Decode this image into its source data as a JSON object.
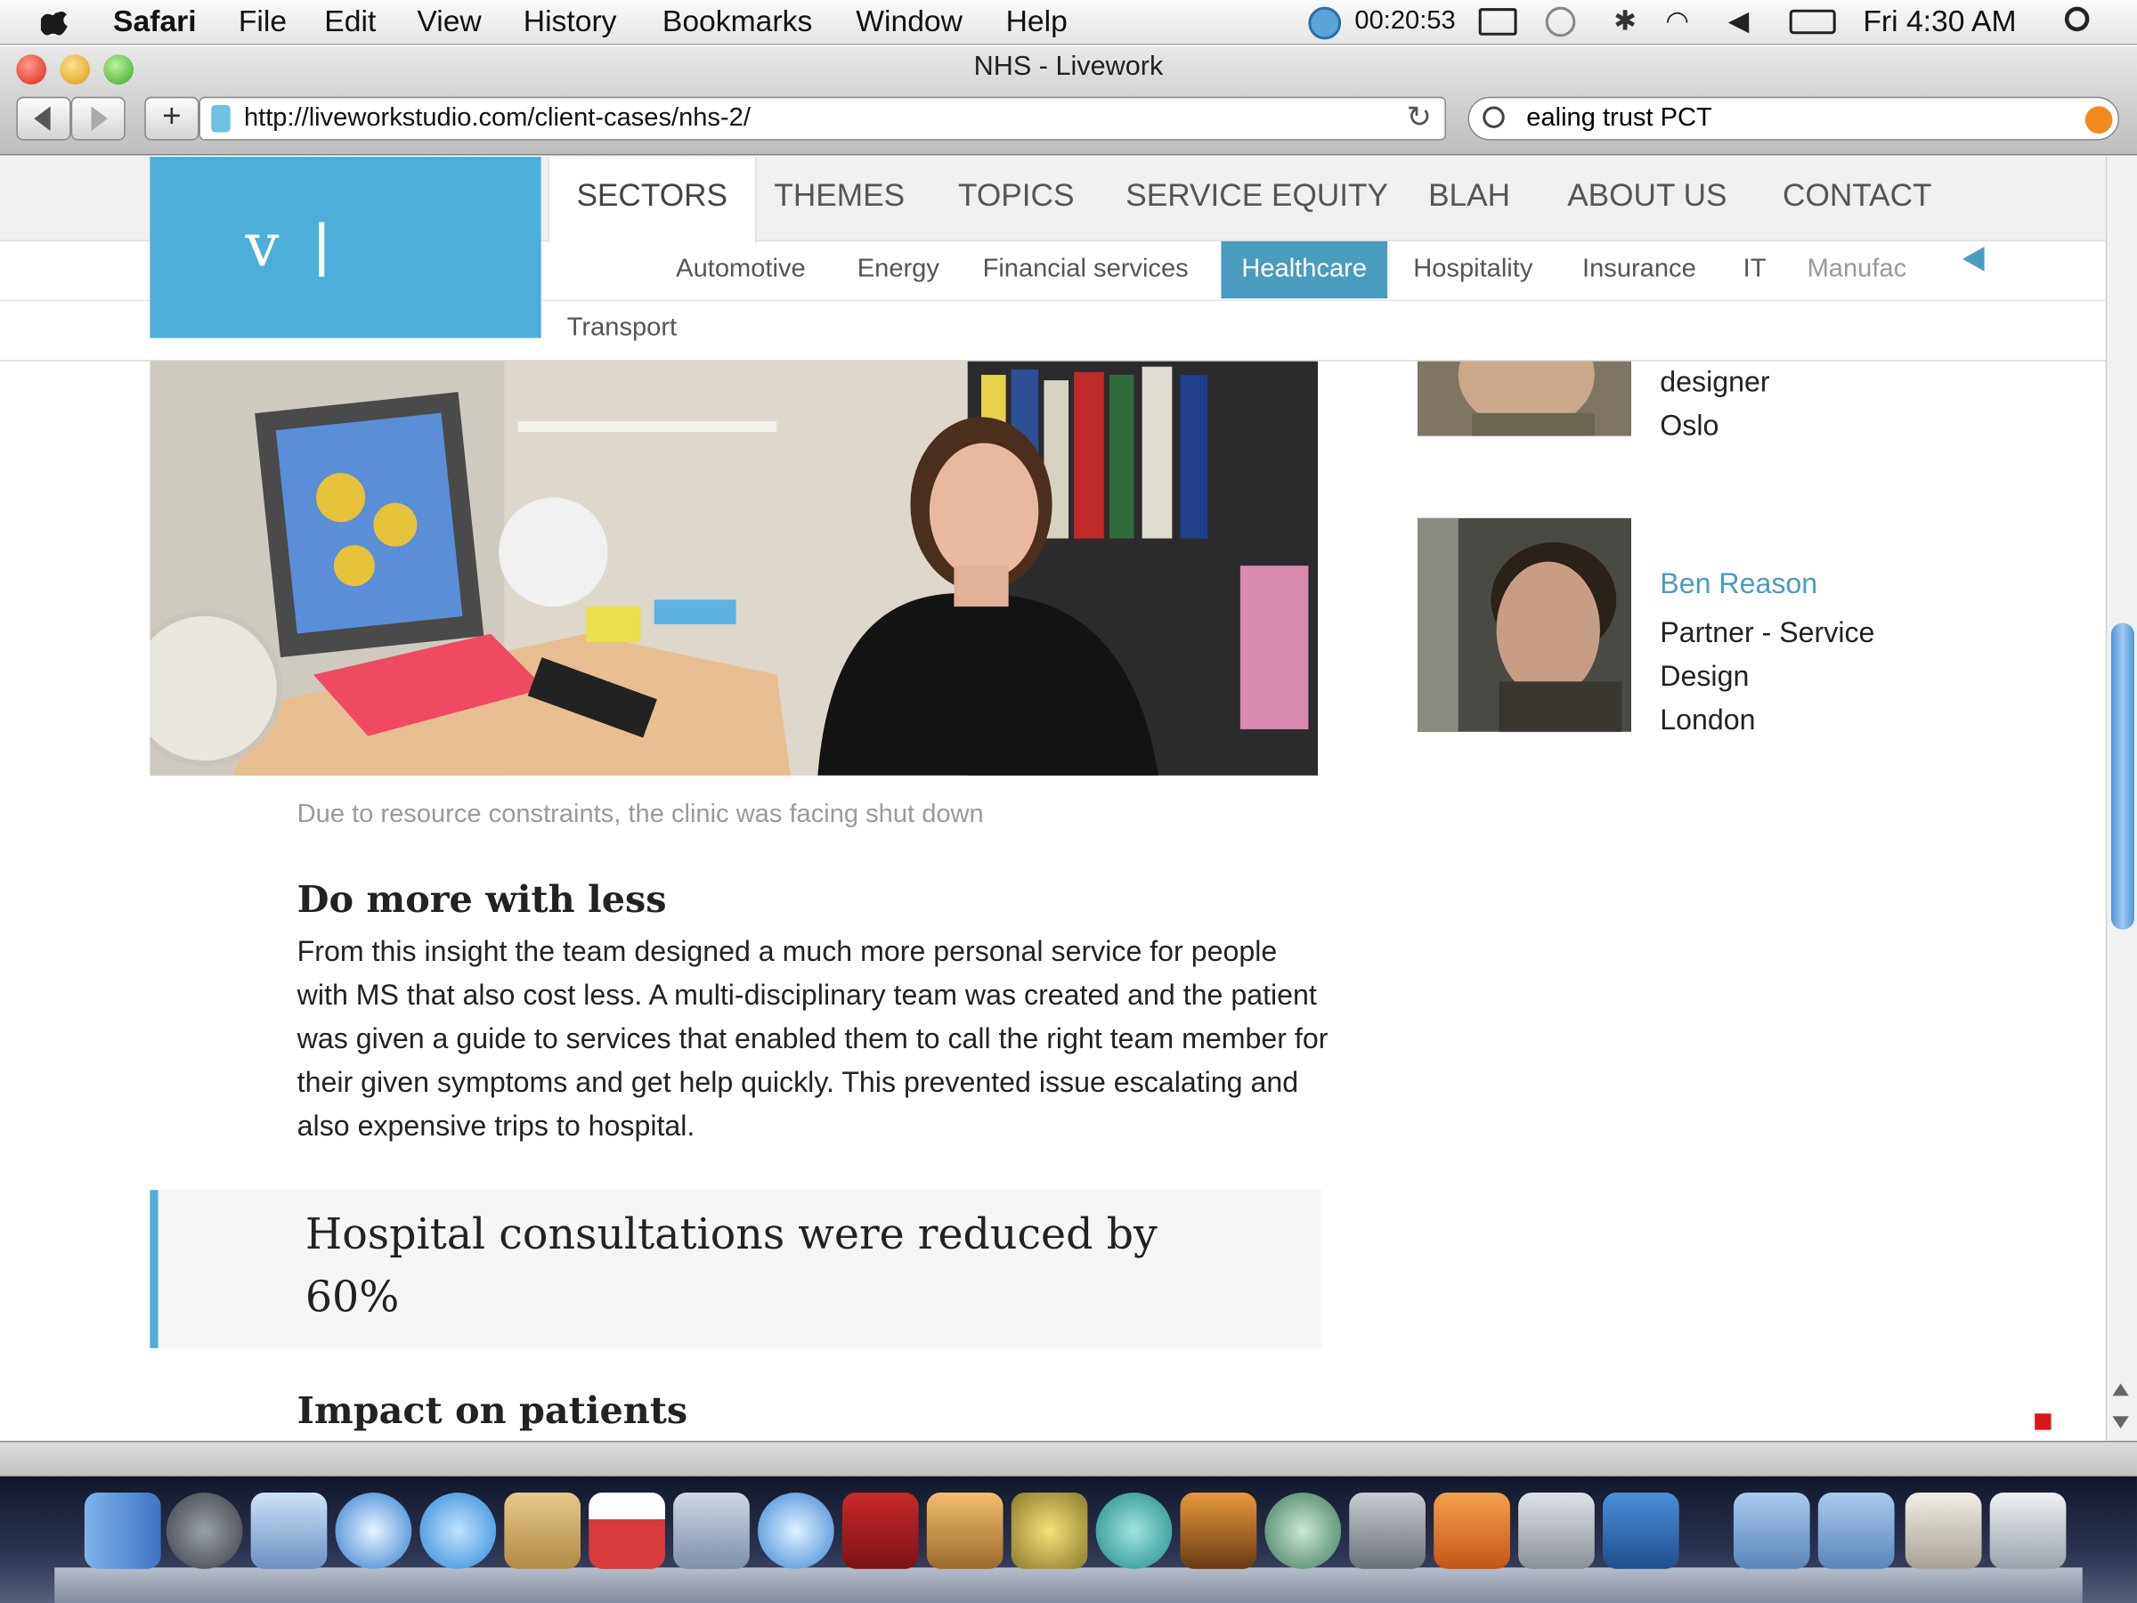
{
  "menubar": {
    "app": "Safari",
    "items": [
      "File",
      "Edit",
      "View",
      "History",
      "Bookmarks",
      "Window",
      "Help"
    ],
    "timer": "00:20:53",
    "clock": "Fri 4:30 AM"
  },
  "window": {
    "title": "NHS - Livework",
    "url": "http://liveworkstudio.com/client-cases/nhs-2/",
    "search": "ealing trust PCT"
  },
  "site": {
    "logo_letter": "v",
    "tabs": [
      "SECTORS",
      "THEMES",
      "TOPICS",
      "SERVICE EQUITY",
      "BLAH",
      "ABOUT US",
      "CONTACT"
    ],
    "subnav": [
      "Automotive",
      "Energy",
      "Financial services",
      "Healthcare",
      "Hospitality",
      "Insurance",
      "IT",
      "Manufac"
    ],
    "subnav_row2": "Transport",
    "selected_subnav": "Healthcare"
  },
  "article": {
    "caption": "Due to resource constraints, the clinic was facing shut down",
    "heading1": "Do more with less",
    "body1": "From this insight the team designed a much more personal service for people with MS that also cost less. A multi-disciplinary team was created and the patient was given a guide to services that enabled them to call the right team member for their given symptoms and get help quickly. This prevented issue escalating and also expensive trips to hospital.",
    "quote": "Hospital consultations were reduced by 60%",
    "heading2": "Impact on patients"
  },
  "people": [
    {
      "role": "designer",
      "city": "Oslo"
    },
    {
      "name": "Ben Reason",
      "role_line1": "Partner - Service",
      "role_line2": "Design",
      "city": "London"
    }
  ],
  "colors": {
    "accent": "#4dafd9",
    "selected": "#4a9cbf"
  }
}
